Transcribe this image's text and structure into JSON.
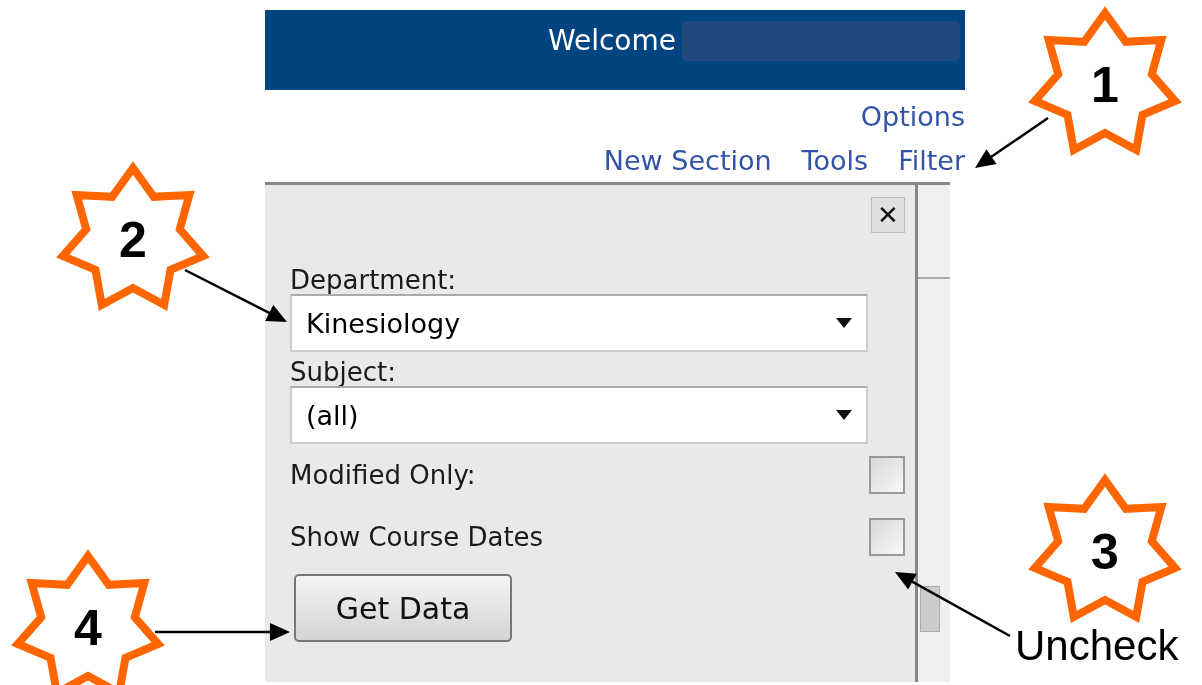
{
  "header": {
    "welcome": "Welcome"
  },
  "options_link": "Options",
  "links": [
    "New Section",
    "Tools",
    "Filter"
  ],
  "filter_panel": {
    "close": "✕",
    "dropdowns": [
      {
        "label": "Department:",
        "value": "Kinesiology"
      },
      {
        "label": "Subject:",
        "value": "(all)"
      }
    ],
    "checkboxes": [
      {
        "label": "Modified Only:",
        "checked": false
      },
      {
        "label": "Show Course Dates",
        "checked": false
      }
    ],
    "button": "Get Data"
  },
  "annotations": [
    {
      "label": "1"
    },
    {
      "label": "2"
    },
    {
      "label": "4"
    },
    {
      "label": "3",
      "note": "Uncheck"
    }
  ]
}
